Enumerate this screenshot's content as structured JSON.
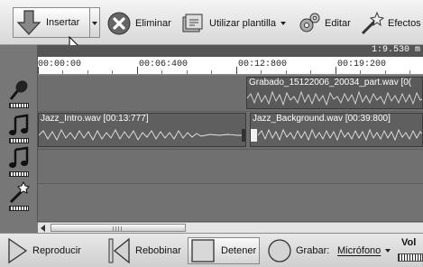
{
  "toolbar": {
    "insert_label": "Insertar",
    "delete_label": "Eliminar",
    "template_label": "Utilizar plantilla",
    "edit_label": "Editar",
    "effects_label": "Efectos"
  },
  "timeline": {
    "duration": "1:9.530 m",
    "ruler_labels": [
      "00:00:00",
      "00:06:400",
      "00:12:800",
      "00:19:200"
    ]
  },
  "clips": {
    "recorded": "Grabado_15122006_20034_part.wav [0(",
    "intro": "Jazz_Intro.wav [00:13:777]",
    "background": "Jazz_Background.wav [00:39:800]"
  },
  "scrollbar": {
    "grip_text": "III"
  },
  "transport": {
    "play_label": "Reproducir",
    "rewind_label": "Rebobinar",
    "stop_label": "Detener",
    "record_label": "Grabar:",
    "record_source": "Micrófono",
    "volume_label": "Vol"
  },
  "icons": [
    "arrow-down-icon",
    "delete-icon",
    "template-icon",
    "edit-gear-icon",
    "effects-wand-icon",
    "microphone-icon",
    "music-note-icon",
    "wand-icon",
    "play-icon",
    "rewind-icon",
    "stop-icon",
    "record-icon"
  ]
}
